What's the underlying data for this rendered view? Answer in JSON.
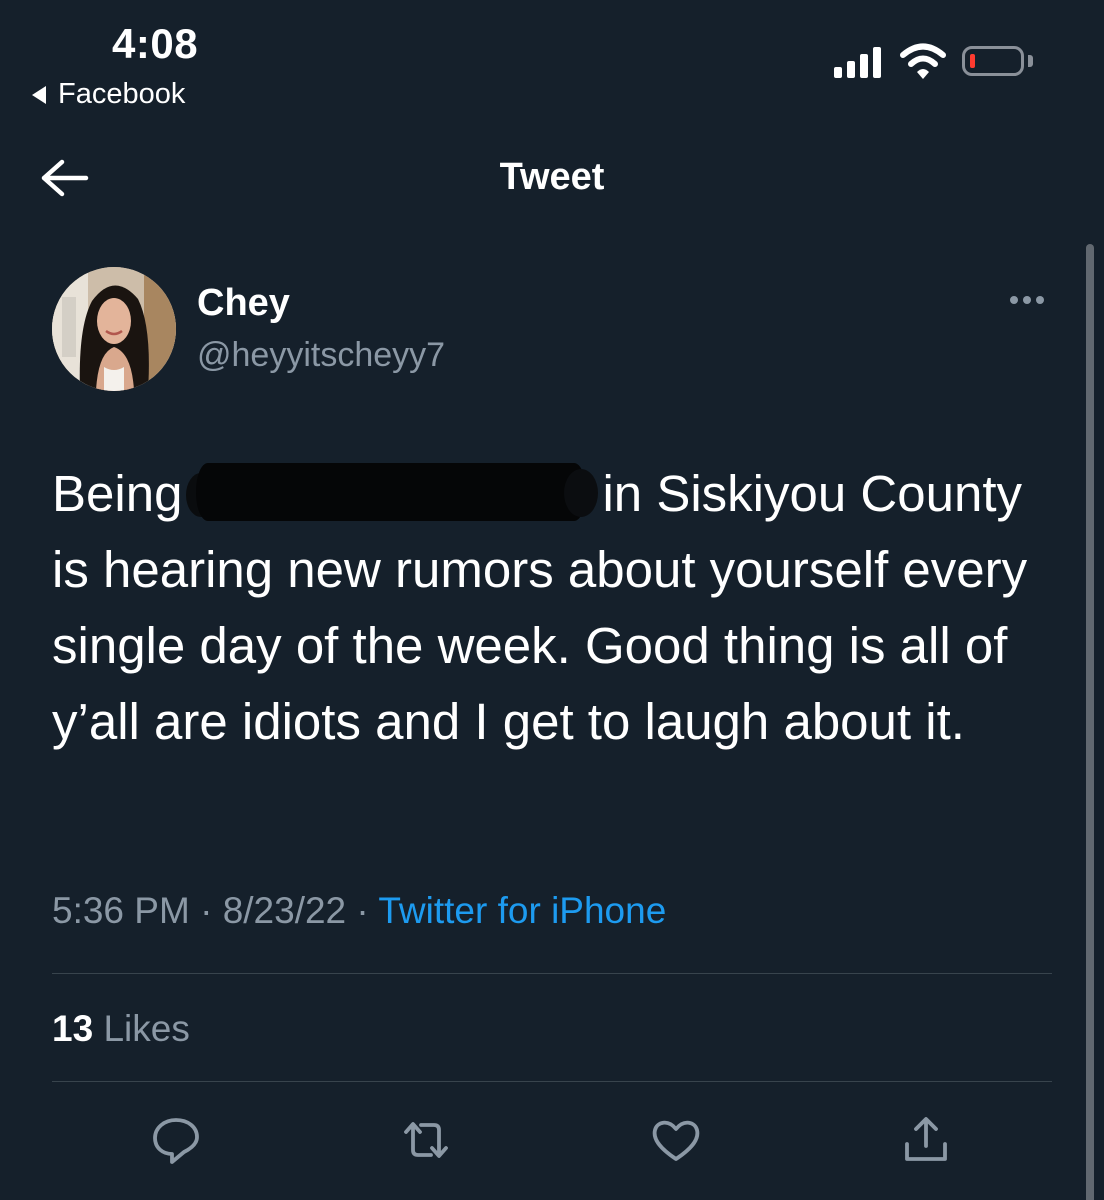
{
  "status_bar": {
    "time": "4:08",
    "back_app": "Facebook",
    "battery_color": "#ff3b30"
  },
  "nav": {
    "title": "Tweet",
    "back_icon": "arrow-left-icon"
  },
  "tweet": {
    "author": {
      "name": "Chey",
      "handle": "@heyyitscheyy7"
    },
    "text_before_redaction": "Being",
    "text_after_redaction": "in Siskiyou County is hearing new rumors about yourself every single day of the week. Good thing is all of y’all are idiots and I get to laugh about it.",
    "time": "5:36 PM",
    "date": "8/23/22",
    "source": "Twitter for iPhone",
    "separator": "·",
    "likes_count": "13",
    "likes_label": "Likes"
  },
  "actions": [
    "reply-icon",
    "retweet-icon",
    "like-icon",
    "share-icon"
  ],
  "colors": {
    "background": "#15202b",
    "secondary_text": "#8b98a5",
    "link": "#1d9bf0",
    "divider": "#38444d"
  }
}
